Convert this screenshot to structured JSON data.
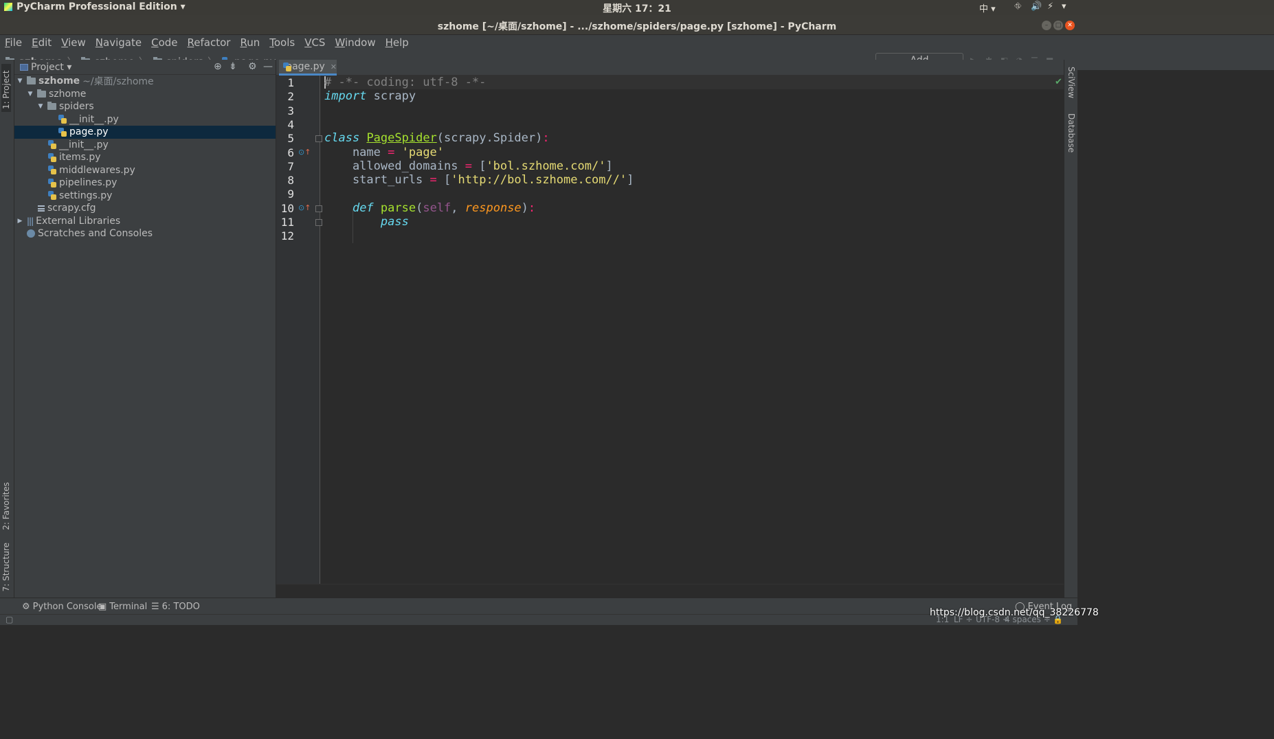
{
  "system": {
    "app_menu": "PyCharm Professional Edition ▾",
    "clock": "星期六 17：21",
    "input_method": "中 ▾"
  },
  "window": {
    "title": "szhome [~/桌面/szhome] - .../szhome/spiders/page.py [szhome] - PyCharm"
  },
  "menu": [
    "File",
    "Edit",
    "View",
    "Navigate",
    "Code",
    "Refactor",
    "Run",
    "Tools",
    "VCS",
    "Window",
    "Help"
  ],
  "breadcrumb": [
    "szhome",
    "szhome",
    "spiders",
    "page.py"
  ],
  "toolbar": {
    "add_configuration": "Add Configuration..."
  },
  "left_strip": {
    "project": "1: Project",
    "favorites": "2: Favorites",
    "structure": "7: Structure"
  },
  "right_strip": {
    "sciview": "SciView",
    "database": "Database"
  },
  "project_panel": {
    "title": "Project ▾",
    "tree": [
      {
        "label": "szhome",
        "extra": "~/桌面/szhome"
      },
      {
        "label": "szhome"
      },
      {
        "label": "spiders"
      },
      {
        "label": "__init__.py"
      },
      {
        "label": "page.py"
      },
      {
        "label": "__init__.py"
      },
      {
        "label": "items.py"
      },
      {
        "label": "middlewares.py"
      },
      {
        "label": "pipelines.py"
      },
      {
        "label": "settings.py"
      },
      {
        "label": "scrapy.cfg"
      },
      {
        "label": "External Libraries"
      },
      {
        "label": "Scratches and Consoles"
      }
    ]
  },
  "editor": {
    "tab": "page.py",
    "line_numbers": [
      "1",
      "2",
      "3",
      "4",
      "5",
      "6",
      "7",
      "8",
      "9",
      "10",
      "11",
      "12"
    ],
    "code": {
      "l1": "# -*- coding: utf-8 -*-",
      "l2_kw": "import",
      "l2_rest": " scrapy",
      "l5_kw": "class",
      "l5_cls": "PageSpider",
      "l5_base": "(scrapy.Spider)",
      "l5_colon": ":",
      "l6_name": "    name ",
      "l6_eq": "=",
      "l6_str": " 'page'",
      "l7_name": "    allowed_domains ",
      "l7_eq": "=",
      "l7_open": " [",
      "l7_str": "'bol.szhome.com/'",
      "l7_close": "]",
      "l8_name": "    start_urls ",
      "l8_eq": "=",
      "l8_open": " [",
      "l8_str": "'http://bol.szhome.com//'",
      "l8_close": "]",
      "l10_indent": "    ",
      "l10_kw": "def",
      "l10_fn": " parse",
      "l10_open": "(",
      "l10_self": "self",
      "l10_comma": ", ",
      "l10_param": "response",
      "l10_close": ")",
      "l10_colon": ":",
      "l11_indent": "        ",
      "l11_pass": "pass"
    }
  },
  "bottom_tools": {
    "python_console": "Python Console",
    "terminal": "Terminal",
    "todo": "6: TODO",
    "event_log": "Event Log"
  },
  "status": {
    "position": "1:1",
    "line_sep": "LF ÷",
    "encoding": "UTF-8 ÷",
    "indent": "4 spaces ÷"
  },
  "watermark": "https://blog.csdn.net/qq_38226778",
  "colors": {
    "background": "#2b2b2b",
    "panel": "#3c3f41",
    "selection": "#0d293e",
    "keyword": "#66d9ef",
    "string": "#e6db74",
    "class": "#a6e22e"
  }
}
